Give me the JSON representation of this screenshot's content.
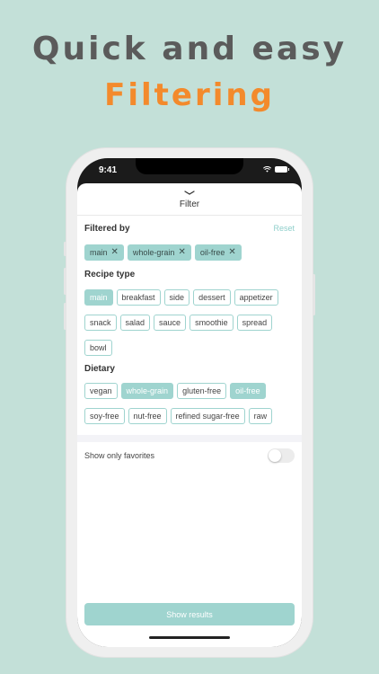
{
  "promo": {
    "line1": "Quick and easy",
    "line2": "Filtering"
  },
  "status_bar": {
    "time": "9:41"
  },
  "sheet": {
    "title": "Filter"
  },
  "filtered_by": {
    "label": "Filtered by",
    "reset": "Reset",
    "chips": [
      "main",
      "whole-grain",
      "oil-free"
    ]
  },
  "recipe_type": {
    "label": "Recipe type",
    "row1": [
      "main",
      "breakfast",
      "side",
      "dessert",
      "appetizer"
    ],
    "row2": [
      "snack",
      "salad",
      "sauce",
      "smoothie",
      "spread"
    ],
    "row3": [
      "bowl"
    ],
    "selected": [
      "main"
    ]
  },
  "dietary": {
    "label": "Dietary",
    "row1": [
      "vegan",
      "whole-grain",
      "gluten-free",
      "oil-free"
    ],
    "row2": [
      "soy-free",
      "nut-free",
      "refined sugar-free",
      "raw"
    ],
    "selected": [
      "whole-grain",
      "oil-free"
    ]
  },
  "favorites": {
    "label": "Show only favorites",
    "enabled": false
  },
  "show_results": "Show results",
  "colors": {
    "background": "#c3e0d8",
    "accent": "#9fd4cf",
    "headline_gray": "#5b5b5b",
    "headline_orange": "#f38a2c"
  }
}
